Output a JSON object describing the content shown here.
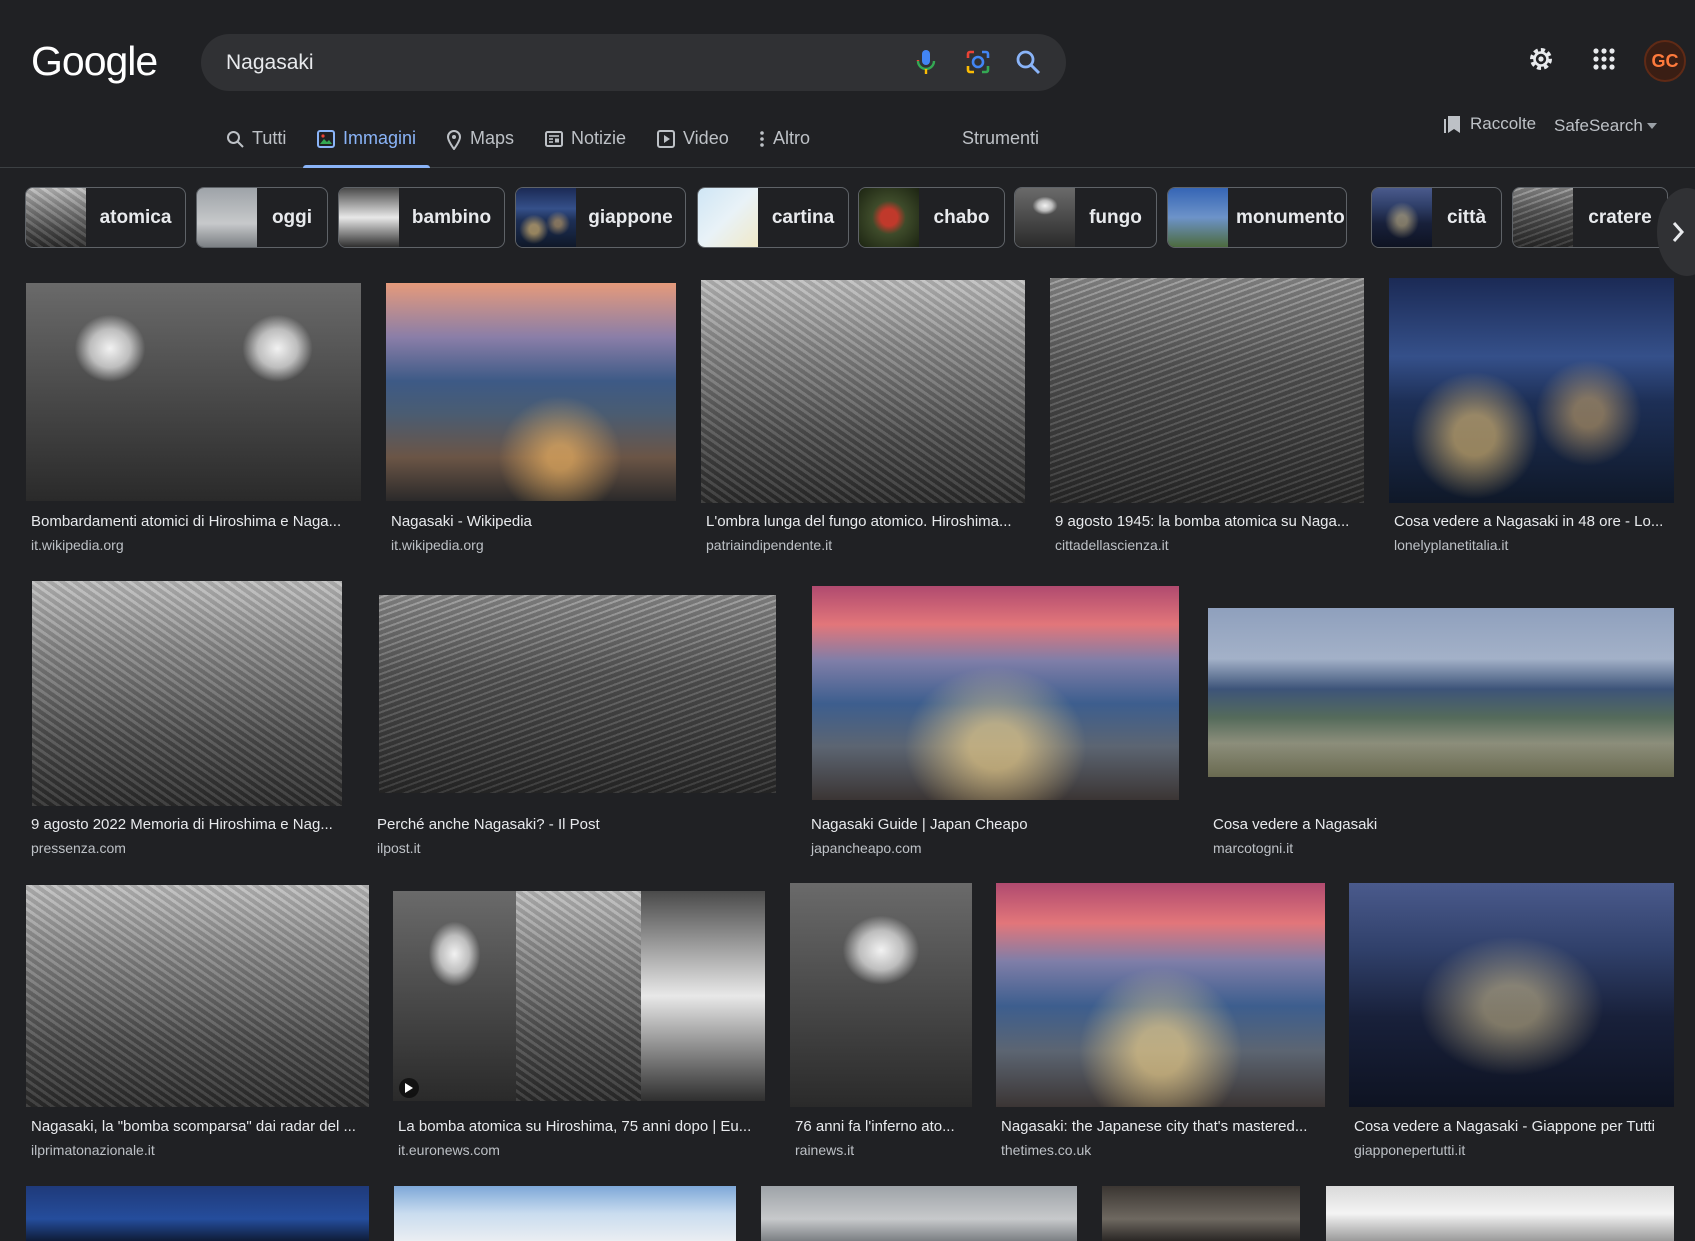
{
  "header": {
    "logo": "Google",
    "search_value": "Nagasaki",
    "avatar_initials": "GC"
  },
  "tabs": [
    {
      "label": "Tutti",
      "icon": "search-icon"
    },
    {
      "label": "Immagini",
      "icon": "image-icon",
      "active": true
    },
    {
      "label": "Maps",
      "icon": "map-pin-icon"
    },
    {
      "label": "Notizie",
      "icon": "news-icon"
    },
    {
      "label": "Video",
      "icon": "video-icon"
    },
    {
      "label": "Altro",
      "icon": "more-vert-icon"
    }
  ],
  "tools_label": "Strumenti",
  "raccolte_label": "Raccolte",
  "safesearch_label": "SafeSearch",
  "chips": [
    {
      "label": "atomica"
    },
    {
      "label": "oggi"
    },
    {
      "label": "bambino"
    },
    {
      "label": "giappone"
    },
    {
      "label": "cartina"
    },
    {
      "label": "chabo"
    },
    {
      "label": "fungo"
    },
    {
      "label": "monumento"
    },
    {
      "label": "città"
    },
    {
      "label": "cratere"
    }
  ],
  "results": [
    {
      "title": "Bombardamenti atomici di Hiroshima e Naga...",
      "source": "it.wikipedia.org"
    },
    {
      "title": "Nagasaki - Wikipedia",
      "source": "it.wikipedia.org"
    },
    {
      "title": "L'ombra lunga del fungo atomico. Hiroshima...",
      "source": "patriaindipendente.it"
    },
    {
      "title": "9 agosto 1945: la bomba atomica su Naga...",
      "source": "cittadellascienza.it"
    },
    {
      "title": "Cosa vedere a Nagasaki in 48 ore - Lo...",
      "source": "lonelyplanetitalia.it"
    },
    {
      "title": "9 agosto 2022 Memoria di Hiroshima e Nag...",
      "source": "pressenza.com"
    },
    {
      "title": "Perché anche Nagasaki? - Il Post",
      "source": "ilpost.it"
    },
    {
      "title": "Nagasaki Guide | Japan Cheapo",
      "source": "japancheapo.com"
    },
    {
      "title": "Cosa vedere a Nagasaki",
      "source": "marcotogni.it"
    },
    {
      "title": "Nagasaki, la \"bomba scomparsa\" dai radar del ...",
      "source": "ilprimatonazionale.it"
    },
    {
      "title": "La bomba atomica su Hiroshima, 75 anni dopo | Eu...",
      "source": "it.euronews.com"
    },
    {
      "title": "76 anni fa l'inferno ato...",
      "source": "rainews.it"
    },
    {
      "title": "Nagasaki: the Japanese city that's mastered...",
      "source": "thetimes.co.uk"
    },
    {
      "title": "Cosa vedere a Nagasaki - Giappone per Tutti",
      "source": "giapponepertutti.it"
    }
  ]
}
